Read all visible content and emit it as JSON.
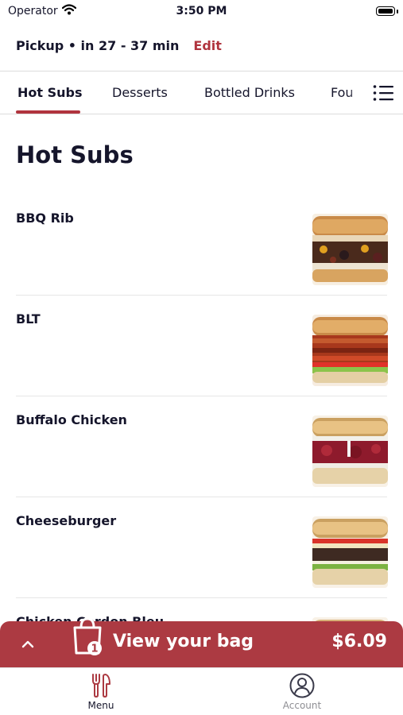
{
  "status_bar": {
    "carrier": "Operator",
    "time": "3:50 PM"
  },
  "pickup": {
    "text": "Pickup • in 27 - 37 min",
    "edit_label": "Edit"
  },
  "category_tabs": [
    {
      "label": "Hot Subs",
      "active": true
    },
    {
      "label": "Desserts",
      "active": false
    },
    {
      "label": "Bottled Drinks",
      "active": false
    },
    {
      "label": "Fou",
      "active": false
    }
  ],
  "section": {
    "title": "Hot Subs"
  },
  "menu_items": [
    {
      "name": "BBQ Rib",
      "image": "bbq-rib-sub"
    },
    {
      "name": "BLT",
      "image": "blt-sub"
    },
    {
      "name": "Buffalo Chicken",
      "image": "buffalo-chicken-sub"
    },
    {
      "name": "Cheeseburger",
      "image": "cheeseburger-sub"
    },
    {
      "name": "Chicken Cordon Bleu",
      "image": "chicken-cordon-bleu-sub"
    }
  ],
  "bag": {
    "label": "View your bag",
    "total": "$6.09",
    "count": "1"
  },
  "bottom_nav": [
    {
      "label": "Menu",
      "icon": "fork-knife-icon",
      "active": true
    },
    {
      "label": "Account",
      "icon": "account-icon",
      "active": false
    }
  ],
  "colors": {
    "accent": "#b0343e",
    "bag_bar": "#ac3a42",
    "text": "#15152b",
    "inactive": "#8e8e93"
  }
}
